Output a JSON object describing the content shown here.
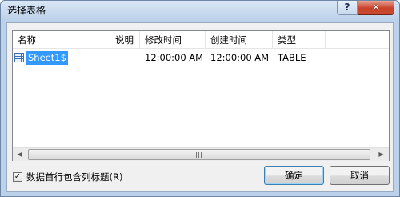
{
  "window": {
    "title": "选择表格",
    "help_glyph": "?",
    "close_glyph": "✕"
  },
  "list": {
    "columns": [
      "名称",
      "说明",
      "修改时间",
      "创建时间",
      "类型"
    ],
    "rows": [
      {
        "name": "Sheet1$",
        "description": "",
        "modified": "12:00:00 AM",
        "created": "12:00:00 AM",
        "type": "TABLE",
        "selected": true
      }
    ]
  },
  "scrollbar": {
    "left_arrow": "◀",
    "right_arrow": "▶"
  },
  "options": {
    "first_row_headers_label": "数据首行包含列标题(R)",
    "first_row_headers_checked": true,
    "check_glyph": "✓"
  },
  "buttons": {
    "ok_label": "确定",
    "cancel_label": "取消"
  },
  "colors": {
    "selection": "#3399ff",
    "close_button": "#c9412a",
    "title_bar": "#bfd3ea"
  }
}
